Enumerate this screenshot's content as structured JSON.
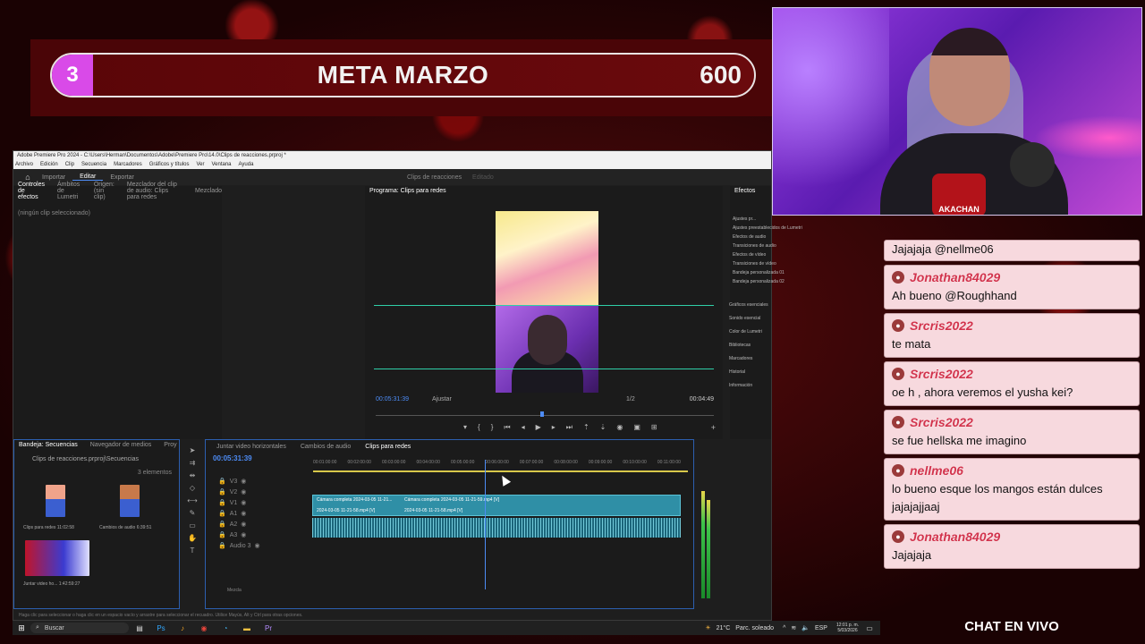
{
  "goal": {
    "current": "3",
    "title": "META MARZO",
    "target": "600",
    "progress_fraction": 0.005,
    "fill_color": "#d94ae8"
  },
  "webcam": {
    "badge_text": "AKACHAN"
  },
  "chat": {
    "header_label": "CHAT EN VIVO",
    "first_partial": "Jajajaja @nellme06",
    "messages": [
      {
        "user": "Jonathan84029",
        "text": "Ah bueno @Roughhand"
      },
      {
        "user": "Srcris2022",
        "text": "te mata"
      },
      {
        "user": "Srcris2022",
        "text": "oe h , ahora veremos el yusha kei?"
      },
      {
        "user": "Srcris2022",
        "text": "se fue hellska me imagino"
      },
      {
        "user": "nellme06",
        "text": "lo bueno esque los mangos están dulces jajajajjaaj"
      },
      {
        "user": "Jonathan84029",
        "text": "Jajajaja"
      }
    ]
  },
  "premiere": {
    "window_title": "Adobe Premiere Pro 2024 - C:\\Users\\Herman\\Documentos\\Adobe\\Premiere Pro\\14.0\\Clips de reacciones.prproj *",
    "menu": [
      "Archivo",
      "Edición",
      "Clip",
      "Secuencia",
      "Marcadores",
      "Gráficos y títulos",
      "Ver",
      "Ventana",
      "Ayuda"
    ],
    "workspaces": [
      "Importar",
      "Editar",
      "Exportar"
    ],
    "active_workspace": "Editar",
    "document_name": "Clips de reacciones",
    "document_state": "Editado",
    "source_tabs": [
      "Controles de efectos",
      "Ámbitos de Lumetri",
      "Origen: (sin clip)",
      "Mezclador del clip de audio: Clips para redes",
      "Mezclado"
    ],
    "no_clip": "(ningún clip seleccionado)",
    "program_tab": "Programa: Clips para redes",
    "program_timecode": "00:05:31:39",
    "fit_label": "Ajustar",
    "ratio": "1/2",
    "duration": "00:04:49",
    "effects_tab": "Efectos",
    "effects_items": [
      "Ajustes pr...",
      "Ajustes preestablecidos de Lumetri",
      "Efectos de audio",
      "Transiciones de audio",
      "Efectos de vídeo",
      "Transiciones de vídeo",
      "Bandeja personalizada 01",
      "Bandeja personalizada 02"
    ],
    "side_panels": [
      "Gráficos esenciales",
      "Sonido esencial",
      "Color de Lumetri",
      "Bibliotecas",
      "Marcadores",
      "Historial",
      "Información"
    ],
    "project_tabs": [
      "Bandeja: Secuencias",
      "Navegador de medios",
      "Proy"
    ],
    "project_path": "Clips de reacciones.prproj\\Secuencias",
    "project_count": "3 elementos",
    "project_items": [
      {
        "name": "Clips para redes",
        "duration": "11:02:58"
      },
      {
        "name": "Cambios de audio",
        "duration": "6:39:51"
      },
      {
        "name": "Juntar video ho...",
        "duration": "1:42:59:27"
      }
    ],
    "sequence_tabs": [
      "Juntar video horizontales",
      "Cambios de audio",
      "Clips para redes"
    ],
    "active_sequence": "Clips para redes",
    "timeline_timecode": "00:05:31:39",
    "ruler_labels": [
      "00:01:00:00",
      "00:02:00:00",
      "00:03:00:00",
      "00:04:00:00",
      "00:05:00:00",
      "00:06:00:00",
      "00:07:00:00",
      "00:08:00:00",
      "00:09:00:00",
      "00:10:00:00",
      "00:11:00:00"
    ],
    "tracks": [
      "V3",
      "V2",
      "V1",
      "A1",
      "A2",
      "A3",
      "Audio 3"
    ],
    "mix_label": "Mezcla",
    "clip_v1a": "Cámara completa 2024-03-05 11-21...",
    "clip_v1b": "Cámara completa 2024-03-05 11-21-59.mp4 [V]",
    "clip_v2a": "2024-03-05 11-21-58.mp4 [V]",
    "clip_v2b": "2024-03-05 11-21-58.mp4 [V]",
    "status_text": "Haga clic para seleccionar o haga clic en un espacio vacío y arrastre para seleccionar el recuadro. Utilice Mayús, Alt y Ctrl para otras opciones."
  },
  "taskbar": {
    "search_placeholder": "Buscar",
    "temperature": "21°C",
    "weather": "Parc. soleado",
    "language": "ESP",
    "time": "12:01 p. m.",
    "date": "5/03/2026"
  }
}
